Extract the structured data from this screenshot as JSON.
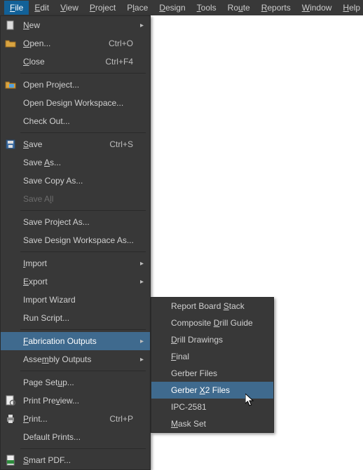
{
  "menubar": {
    "items": [
      {
        "label": "File",
        "ul": "F",
        "rest": "ile",
        "active": true
      },
      {
        "label": "Edit",
        "ul": "E",
        "rest": "dit"
      },
      {
        "label": "View",
        "ul": "V",
        "rest": "iew"
      },
      {
        "label": "Project",
        "ul": "P",
        "rest": "roject"
      },
      {
        "label": "Place",
        "ul": "P",
        "rest1": "",
        "pre": "",
        "custom": "P<u>l</u>ace"
      },
      {
        "label": "Design",
        "ul": "D",
        "rest": "esign"
      },
      {
        "label": "Tools",
        "ul": "T",
        "rest": "ools"
      },
      {
        "label": "Route",
        "ul": "R",
        "pre": "Ro",
        "ulchar": "u",
        "post": "te"
      },
      {
        "label": "Reports",
        "ul": "R",
        "rest": "eports"
      },
      {
        "label": "Window",
        "ul": "W",
        "rest": "indow"
      },
      {
        "label": "Help",
        "ul": "H",
        "rest": "elp"
      }
    ]
  },
  "dropdown": {
    "groups": [
      [
        {
          "label": "New",
          "ul": "N",
          "rest": "ew",
          "icon": "new-icon",
          "arrow": true
        },
        {
          "label": "Open...",
          "ul": "O",
          "rest": "pen...",
          "icon": "open-icon",
          "shortcut": "Ctrl+O"
        },
        {
          "label": "Close",
          "ul": "C",
          "rest": "lose",
          "shortcut": "Ctrl+F4"
        }
      ],
      [
        {
          "label": "Open Project...",
          "icon": "open-project-icon",
          "plain": true
        },
        {
          "label": "Open Design Workspace...",
          "plain": true
        },
        {
          "label": "Check Out...",
          "plain": true
        }
      ],
      [
        {
          "label": "Save",
          "ul": "S",
          "rest": "ave",
          "icon": "save-icon",
          "shortcut": "Ctrl+S"
        },
        {
          "label": "Save As...",
          "pre": "Save ",
          "ul": "A",
          "rest": "s...",
          "plain": false
        },
        {
          "label": "Save Copy As...",
          "plain": true
        },
        {
          "label": "Save All",
          "pre": "Save A",
          "ul": "l",
          "rest": "l",
          "disabled": true
        }
      ],
      [
        {
          "label": "Save Project As...",
          "plain": true
        },
        {
          "label": "Save Design Workspace As...",
          "plain": true
        }
      ],
      [
        {
          "label": "Import",
          "ul": "I",
          "rest": "mport",
          "arrow": true
        },
        {
          "label": "Export",
          "ul": "E",
          "rest": "xport",
          "arrow": true
        },
        {
          "label": "Import Wizard",
          "plain": true
        },
        {
          "label": "Run Script...",
          "plain": true
        }
      ],
      [
        {
          "label": "Fabrication Outputs",
          "ul": "F",
          "rest": "abrication Outputs",
          "arrow": true,
          "highlighted": true
        },
        {
          "label": "Assembly Outputs",
          "pre": "Asse",
          "ul": "m",
          "rest": "bly Outputs",
          "arrow": true
        }
      ],
      [
        {
          "label": "Page Setup...",
          "pre": "Page Set",
          "ul": "u",
          "rest": "p..."
        },
        {
          "label": "Print Preview...",
          "pre": "Print Pre",
          "ul": "v",
          "rest": "iew...",
          "icon": "preview-icon"
        },
        {
          "label": "Print...",
          "ul": "P",
          "rest": "rint...",
          "icon": "print-icon",
          "shortcut": "Ctrl+P"
        },
        {
          "label": "Default Prints...",
          "plain": true
        }
      ],
      [
        {
          "label": "Smart PDF...",
          "ul": "S",
          "rest": "mart PDF...",
          "icon": "pdf-icon"
        }
      ]
    ]
  },
  "submenu": {
    "items": [
      {
        "label": "Report Board Stack",
        "pre": "Report Board ",
        "ul": "S",
        "rest": "tack"
      },
      {
        "label": "Composite Drill Guide",
        "pre": "Composite ",
        "ul": "D",
        "rest": "rill Guide"
      },
      {
        "label": "Drill Drawings",
        "ul": "D",
        "rest": "rill Drawings"
      },
      {
        "label": "Final",
        "ul": "F",
        "rest": "inal"
      },
      {
        "label": "Gerber Files",
        "plain": true
      },
      {
        "label": "Gerber X2 Files",
        "pre": "Gerber ",
        "ul": "X",
        "rest": "2 Files",
        "highlighted": true
      },
      {
        "label": "IPC-2581",
        "plain": true
      },
      {
        "label": "Mask Set",
        "ul": "M",
        "rest": "ask Set"
      }
    ]
  }
}
